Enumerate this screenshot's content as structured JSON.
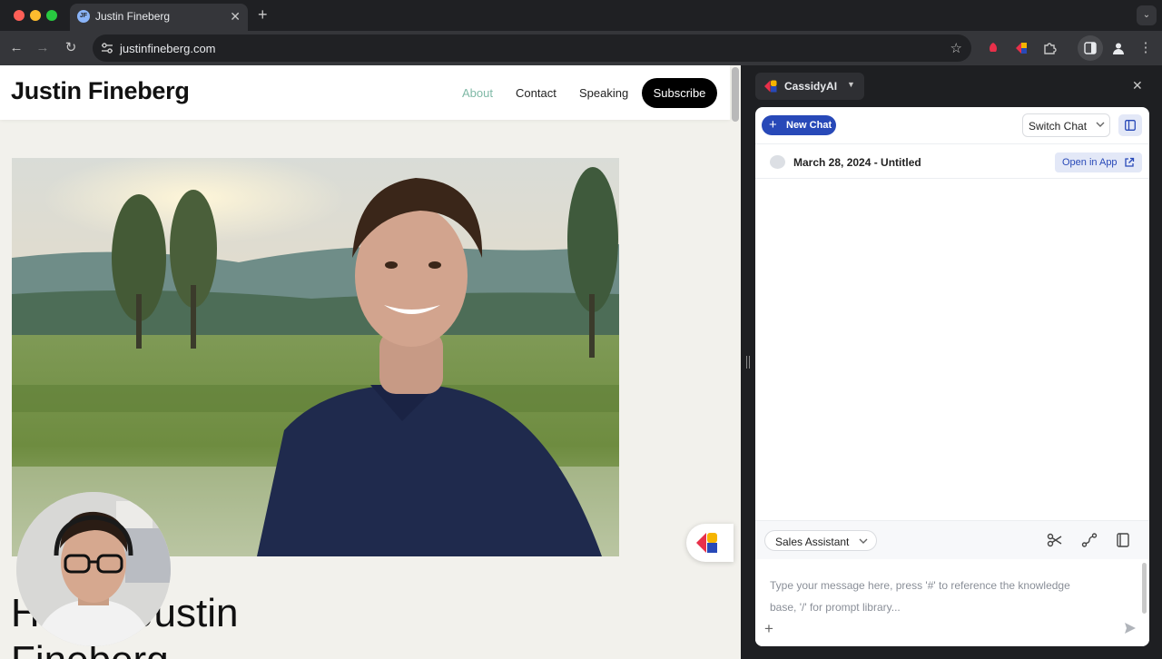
{
  "browser": {
    "tab": {
      "favicon_text": "JF",
      "title": "Justin Fineberg"
    },
    "address": {
      "url": "justinfineberg.com"
    }
  },
  "site": {
    "title": "Justin Fineberg",
    "nav": [
      {
        "label": "About",
        "active": true
      },
      {
        "label": "Contact"
      },
      {
        "label": "Speaking"
      }
    ],
    "subscribe_label": "Subscribe",
    "hero_heading_line1": "Hi, I'm Justin",
    "hero_heading_line2": "Fineberg",
    "accent_color": "#7fb9a6"
  },
  "panel": {
    "app_name": "CassidyAI",
    "new_chat_label": "New Chat",
    "switch_chat_label": "Switch Chat",
    "chat_title": "March 28, 2024 - Untitled",
    "open_in_app_label": "Open in App",
    "assistant_label": "Sales Assistant",
    "message_placeholder": "Type your message here, press '#' to reference the knowledge base, '/' for prompt library...",
    "brand_color": "#2849b8",
    "icons": [
      "scissors-icon",
      "route-icon",
      "book-icon",
      "send-icon",
      "plus-icon"
    ]
  }
}
